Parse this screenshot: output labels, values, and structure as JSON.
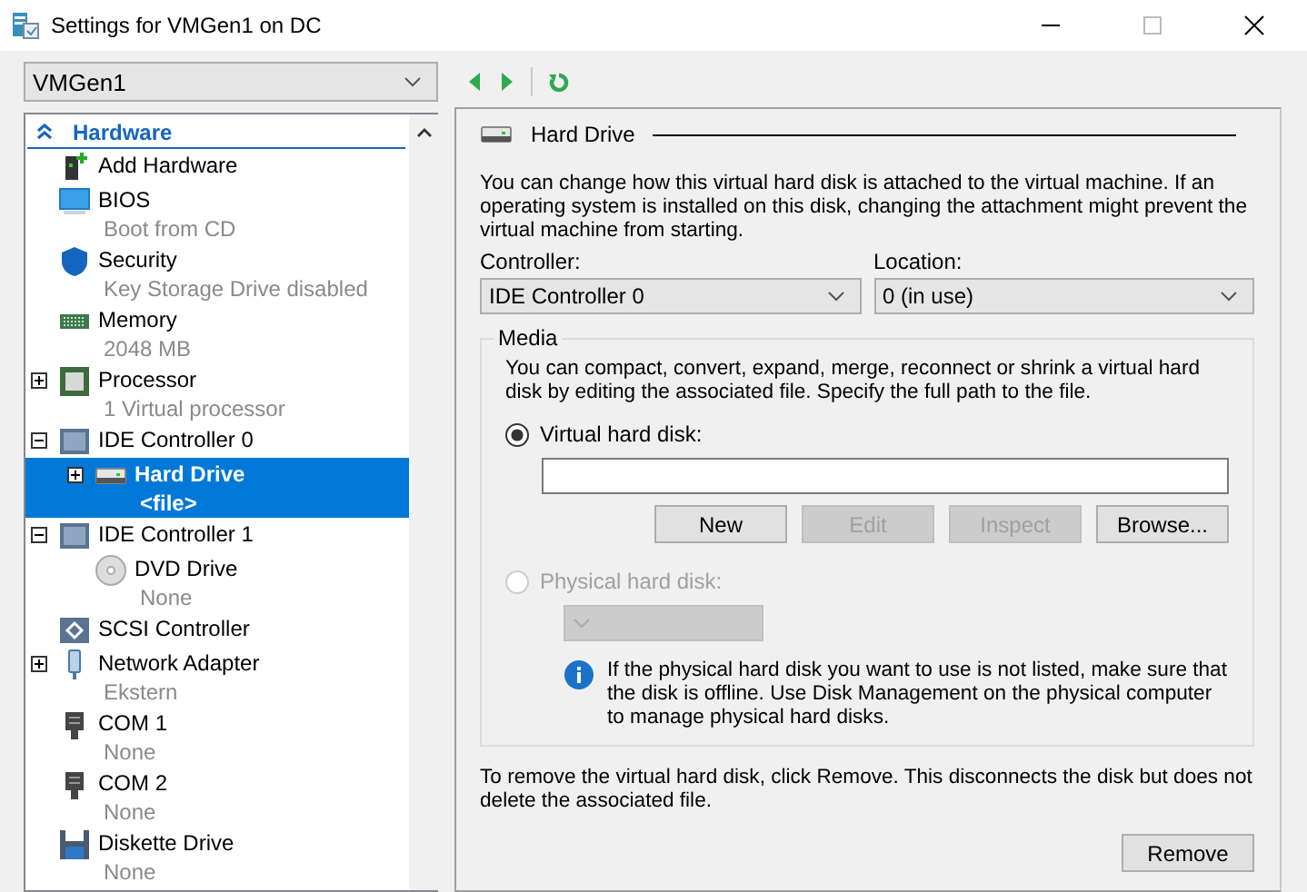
{
  "window": {
    "title": "Settings for VMGen1 on DC"
  },
  "vm_selector": {
    "value": "VMGen1"
  },
  "sidebar": {
    "section": {
      "label": "Hardware",
      "expanded": true
    },
    "items": [
      {
        "label": "Add Hardware",
        "kind": "add"
      },
      {
        "label": "BIOS",
        "sub": "Boot from CD",
        "kind": "bios"
      },
      {
        "label": "Security",
        "sub": "Key Storage Drive disabled",
        "kind": "security"
      },
      {
        "label": "Memory",
        "sub": "2048 MB",
        "kind": "memory"
      },
      {
        "label": "Processor",
        "sub": "1 Virtual processor",
        "kind": "processor",
        "expanded": false
      },
      {
        "label": "IDE Controller 0",
        "kind": "controller",
        "expanded": true,
        "children": [
          {
            "label": "Hard Drive",
            "sub": "<file>",
            "kind": "drive",
            "expanded": false,
            "selected": true
          }
        ]
      },
      {
        "label": "IDE Controller 1",
        "kind": "controller",
        "expanded": true,
        "children": [
          {
            "label": "DVD Drive",
            "sub": "None",
            "kind": "dvd"
          }
        ]
      },
      {
        "label": "SCSI Controller",
        "kind": "scsi"
      },
      {
        "label": "Network Adapter",
        "sub": "Ekstern",
        "kind": "network",
        "expanded": false
      },
      {
        "label": "COM 1",
        "sub": "None",
        "kind": "com"
      },
      {
        "label": "COM 2",
        "sub": "None",
        "kind": "com"
      },
      {
        "label": "Diskette Drive",
        "sub": "None",
        "kind": "diskette"
      }
    ]
  },
  "panel": {
    "title": "Hard Drive",
    "description": "You can change how this virtual hard disk is attached to the virtual machine. If an operating system is installed on this disk, changing the attachment might prevent the virtual machine from starting.",
    "controller": {
      "label": "Controller:",
      "value": "IDE Controller 0"
    },
    "location": {
      "label": "Location:",
      "value": "0 (in use)"
    },
    "media": {
      "legend": "Media",
      "description": "You can compact, convert, expand, merge, reconnect or shrink a virtual hard disk by editing the associated file. Specify the full path to the file.",
      "virtual": {
        "label": "Virtual hard disk:",
        "selected": true,
        "disabled": false
      },
      "buttons": [
        {
          "label": "New",
          "disabled": false
        },
        {
          "label": "Edit",
          "disabled": true
        },
        {
          "label": "Inspect",
          "disabled": true
        },
        {
          "label": "Browse...",
          "disabled": false
        }
      ],
      "physical": {
        "label": "Physical hard disk:",
        "selected": false,
        "disabled": true
      },
      "info": "If the physical hard disk you want to use is not listed, make sure that the disk is offline. Use Disk Management on the physical computer to manage physical hard disks."
    },
    "remove_note": "To remove the virtual hard disk, click Remove. This disconnects the disk but does not delete the associated file.",
    "remove_button": {
      "label": "Remove"
    }
  }
}
